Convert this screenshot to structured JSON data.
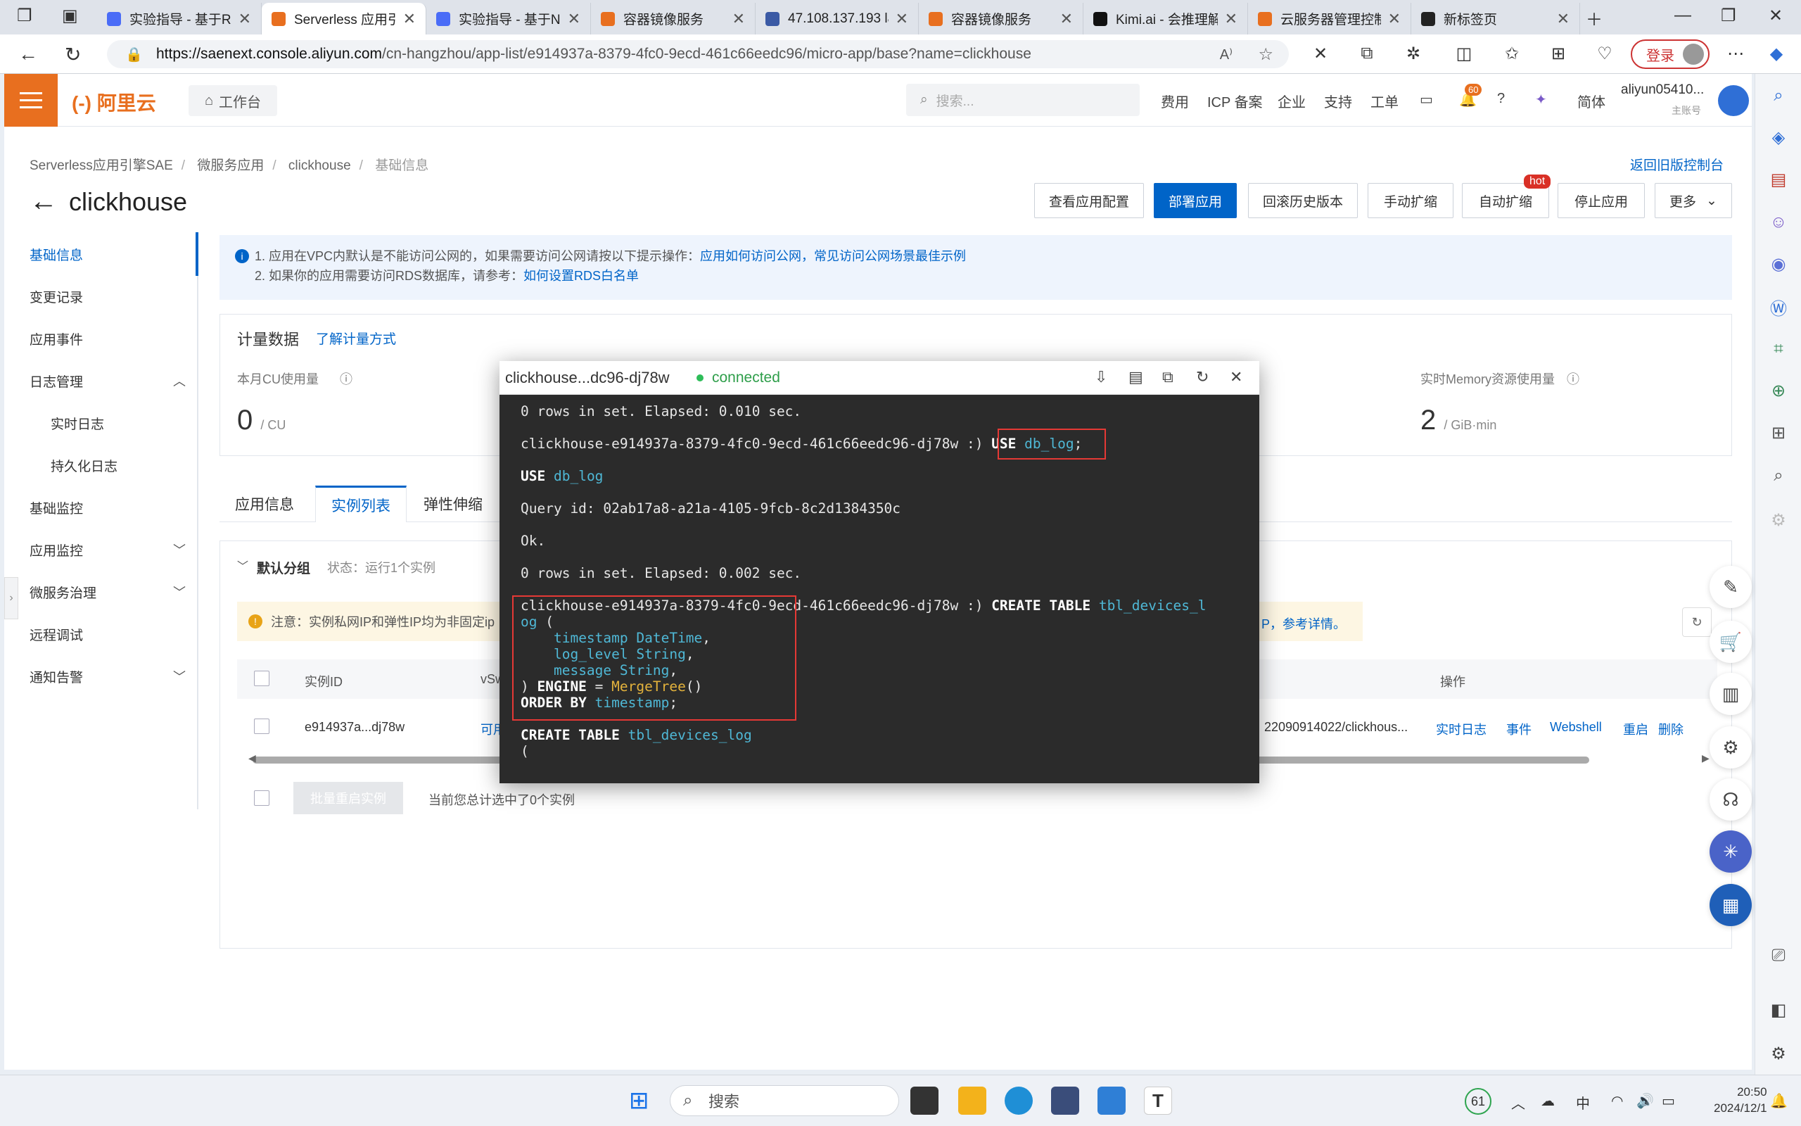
{
  "browser": {
    "tabs": [
      {
        "title": "实验指导 - 基于R",
        "color": "#4a6cf7"
      },
      {
        "title": "Serverless 应用引",
        "color": "#e86f1f",
        "active": true
      },
      {
        "title": "实验指导 - 基于N",
        "color": "#4a6cf7"
      },
      {
        "title": "容器镜像服务",
        "color": "#e86f1f"
      },
      {
        "title": "47.108.137.193 la",
        "color": "#3b5aa5"
      },
      {
        "title": "容器镜像服务",
        "color": "#e86f1f"
      },
      {
        "title": "Kimi.ai - 会推理解",
        "color": "#111111"
      },
      {
        "title": "云服务器管理控制",
        "color": "#e86f1f"
      },
      {
        "title": "新标签页",
        "color": "#222222"
      }
    ],
    "url_host": "https://saenext.console.aliyun.com",
    "url_path": "/cn-hangzhou/app-list/e914937a-8379-4fc0-9ecd-461c66eedc96/micro-app/base?name=clickhouse",
    "login_label": "登录"
  },
  "console": {
    "logo": "(-) 阿里云",
    "workbench": "工作台",
    "search_placeholder": "搜索...",
    "nav": [
      "费用",
      "ICP 备案",
      "企业",
      "支持",
      "工单"
    ],
    "bell_badge": "60",
    "lang": "简体",
    "user": "aliyun05410...",
    "user_sub": "主账号"
  },
  "page": {
    "breadcrumb": [
      "Serverless应用引擎SAE",
      "微服务应用",
      "clickhouse",
      "基础信息"
    ],
    "back_link": "返回旧版控制台",
    "title": "clickhouse",
    "actions": [
      "查看应用配置",
      "部署应用",
      "回滚历史版本",
      "手动扩缩",
      "自动扩缩",
      "停止应用",
      "更多"
    ],
    "hot": "hot",
    "leftnav": {
      "items": [
        "基础信息",
        "变更记录",
        "应用事件",
        "日志管理",
        "实时日志",
        "持久化日志",
        "基础监控",
        "应用监控",
        "微服务治理",
        "远程调试",
        "通知告警"
      ]
    },
    "notice": {
      "line1": "1. 应用在VPC内默认是不能访问公网的，如果需要访问公网请按以下提示操作：",
      "line1_link": "应用如何访问公网，常见访问公网场景最佳示例",
      "line2": "2. 如果你的应用需要访问RDS数据库，请参考：",
      "line2_link": "如何设置RDS白名单"
    },
    "metrics": {
      "title": "计量数据",
      "link": "了解计量方式",
      "cu_label": "本月CU使用量",
      "cu_value": "0",
      "cu_unit": "/ CU",
      "mem_label": "实时Memory资源使用量",
      "mem_value": "2",
      "mem_unit": "/ GiB·min"
    },
    "tabs": [
      "应用信息",
      "实例列表",
      "弹性伸缩"
    ],
    "group": {
      "name": "默认分组",
      "state": "状态：运行1个实例",
      "warning": "注意：实例私网IP和弹性IP均为非固定ip",
      "warning_tail": "P，参考详情。",
      "columns": [
        "实例ID",
        "vSwi",
        "操作"
      ],
      "row": {
        "id": "e914937a...dj78w",
        "vswitch": "可用",
        "image": "22090914022/clickhous...",
        "ops": [
          "实时日志",
          "事件",
          "Webshell",
          "重启",
          "删除"
        ]
      },
      "batch_btn": "批量重启实例",
      "footnote": "当前您总计选中了0个实例"
    }
  },
  "terminal": {
    "title": "clickhouse...dc96-dj78w",
    "status": "connected",
    "lines": [
      [
        {
          "t": "0 rows in set. Elapsed: 0.010 sec."
        }
      ],
      [],
      [
        {
          "t": "clickhouse-e914937a-8379-4fc0-9ecd-461c66eedc96-dj78w :) "
        },
        {
          "t": "USE",
          "c": "kw"
        },
        {
          "t": " "
        },
        {
          "t": "db_log",
          "c": "id"
        },
        {
          "t": ";"
        }
      ],
      [],
      [
        {
          "t": "USE",
          "c": "kw"
        },
        {
          "t": " "
        },
        {
          "t": "db_log",
          "c": "id"
        }
      ],
      [],
      [
        {
          "t": "Query id: 02ab17a8-a21a-4105-9fcb-8c2d1384350c"
        }
      ],
      [],
      [
        {
          "t": "Ok."
        }
      ],
      [],
      [
        {
          "t": "0 rows in set. Elapsed: 0.002 sec."
        }
      ],
      [],
      [
        {
          "t": "clickhouse-e914937a-8379-4fc0-9ecd-461c66eedc96-dj78w :) "
        },
        {
          "t": "CREATE TABLE",
          "c": "kw"
        },
        {
          "t": " "
        },
        {
          "t": "tbl_devices_l",
          "c": "id"
        }
      ],
      [
        {
          "t": "og",
          "c": "id"
        },
        {
          "t": " ("
        }
      ],
      [
        {
          "t": "    "
        },
        {
          "t": "timestamp DateTime",
          "c": "id"
        },
        {
          "t": ","
        }
      ],
      [
        {
          "t": "    "
        },
        {
          "t": "log_level String",
          "c": "id"
        },
        {
          "t": ","
        }
      ],
      [
        {
          "t": "    "
        },
        {
          "t": "message String",
          "c": "id"
        },
        {
          "t": ","
        }
      ],
      [
        {
          "t": ") "
        },
        {
          "t": "ENGINE",
          "c": "kw"
        },
        {
          "t": " = "
        },
        {
          "t": "MergeTree",
          "c": "fn"
        },
        {
          "t": "()"
        }
      ],
      [
        {
          "t": "ORDER BY",
          "c": "kw"
        },
        {
          "t": " "
        },
        {
          "t": "timestamp",
          "c": "id"
        },
        {
          "t": ";"
        }
      ],
      [],
      [
        {
          "t": "CREATE TABLE",
          "c": "kw"
        },
        {
          "t": " "
        },
        {
          "t": "tbl_devices_log",
          "c": "id"
        }
      ],
      [
        {
          "t": "("
        }
      ]
    ]
  },
  "taskbar": {
    "search": "搜索",
    "tray_badge": "61",
    "ime": "中",
    "time": "20:50",
    "date": "2024/12/1"
  }
}
